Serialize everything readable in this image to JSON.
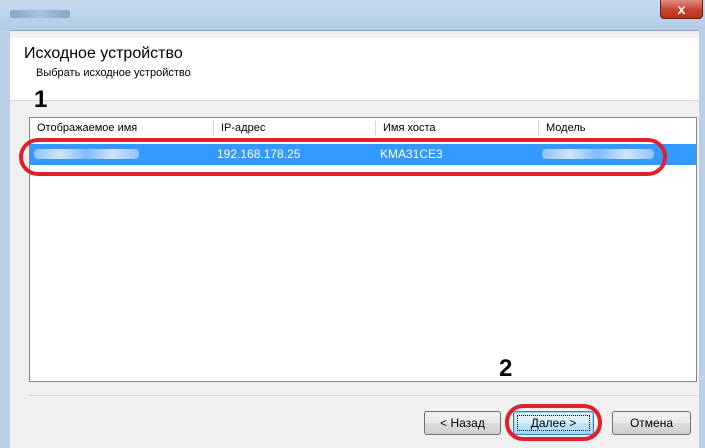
{
  "window": {
    "close_glyph": "x"
  },
  "header": {
    "title": "Исходное устройство",
    "subtitle": "Выбрать исходное устройство"
  },
  "markers": {
    "step1": "1",
    "step2": "2"
  },
  "list": {
    "columns": [
      "Отображаемое имя",
      "IP-адрес",
      "Имя хоста",
      "Модель"
    ],
    "rows": [
      {
        "ip": "192.168.178.25",
        "hostname": "KMA31CE3",
        "selected": true
      }
    ]
  },
  "buttons": {
    "back": "< Назад",
    "next": "Далее >",
    "cancel": "Отмена"
  },
  "colors": {
    "selection": "#3399ff",
    "highlight": "#e0202a"
  }
}
